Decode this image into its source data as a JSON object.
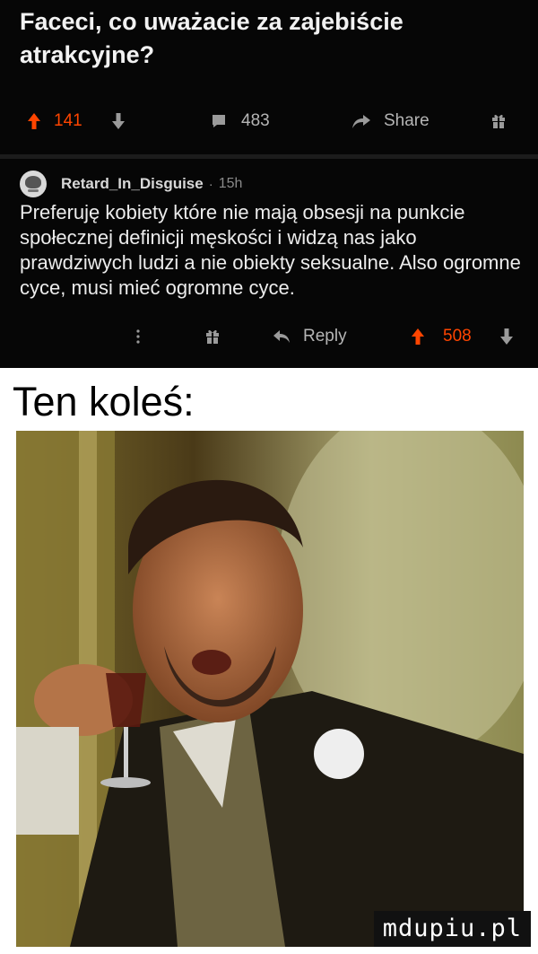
{
  "post": {
    "title": "Faceci, co uważacie za zajebiście atrakcyjne?",
    "upvotes": "141",
    "comments": "483",
    "share_label": "Share"
  },
  "comment": {
    "username": "Retard_In_Disguise",
    "separator": "·",
    "time": "15h",
    "text": "Preferuję kobiety które nie mają obsesji na punkcie społecznej definicji męskości i widzą nas jako prawdziwych ludzi a nie obiekty seksualne. Also ogromne cyce, musi mieć ogromne cyce.",
    "reply_label": "Reply",
    "upvotes": "508"
  },
  "meme": {
    "caption": "Ten koleś:",
    "watermark": "mdupiu.pl"
  },
  "icons": {
    "upvote": "arrow-up-icon",
    "downvote": "arrow-down-icon",
    "comment": "comment-bubble-icon",
    "share": "share-arrow-icon",
    "award": "gift-icon",
    "more": "more-dots-icon",
    "reply": "reply-arrow-icon"
  },
  "colors": {
    "upvote_orange": "#ff4500",
    "background": "#060606",
    "meme_bg": "#ffffff"
  }
}
